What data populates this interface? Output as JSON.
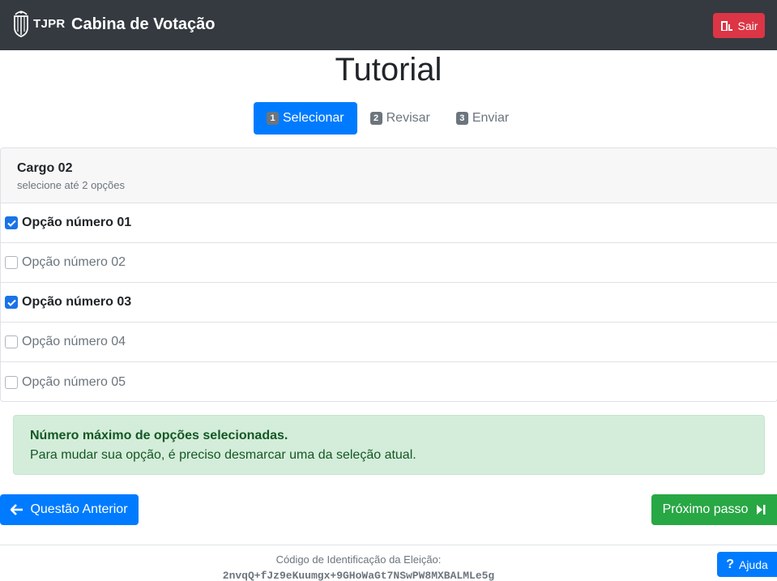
{
  "header": {
    "logo_text": "TJPR",
    "app_title": "Cabina de Votação",
    "exit_label": "Sair",
    "exit_color": "#dc3545"
  },
  "page": {
    "title": "Tutorial"
  },
  "steps": [
    {
      "num": "1",
      "label": "Selecionar",
      "active": true
    },
    {
      "num": "2",
      "label": "Revisar",
      "active": false
    },
    {
      "num": "3",
      "label": "Enviar",
      "active": false
    }
  ],
  "ballot": {
    "position_title": "Cargo 02",
    "instruction": "selecione até 2 opções",
    "options": [
      {
        "label": "Opção número 01",
        "checked": true
      },
      {
        "label": "Opção número 02",
        "checked": false
      },
      {
        "label": "Opção número 03",
        "checked": true
      },
      {
        "label": "Opção número 04",
        "checked": false
      },
      {
        "label": "Opção número 05",
        "checked": false
      }
    ]
  },
  "alert": {
    "title": "Número máximo de opções selecionadas.",
    "text": "Para mudar sua opção, é preciso desmarcar uma da seleção atual."
  },
  "nav": {
    "prev_label": "Questão Anterior",
    "next_label": "Próximo passo"
  },
  "footer": {
    "election_id_label": "Código de Identificação da Eleição:",
    "election_id": "2nvqQ+fJz9eKuumgx+9GHoWaGt7NSwPW8MXBALMLe5g"
  },
  "help": {
    "label": "Ajuda"
  },
  "icons": {
    "logo": "tjpr-shield-icon",
    "exit": "door-exit-icon",
    "prev": "arrow-left-icon",
    "next": "step-forward-icon",
    "help": "question-icon",
    "check": "check-icon"
  }
}
